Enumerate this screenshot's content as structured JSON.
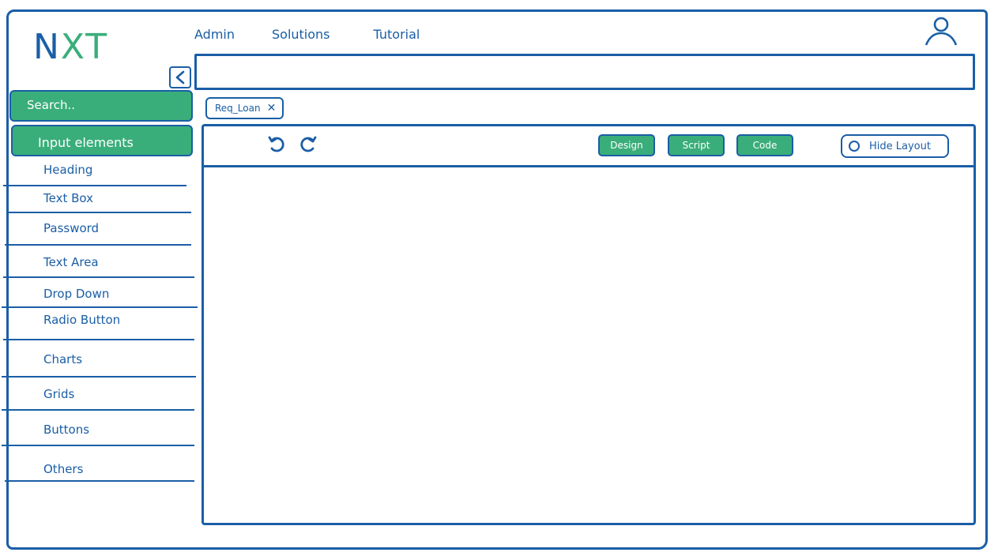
{
  "brand": {
    "logo_text": [
      "N",
      "X",
      "T"
    ]
  },
  "topnav": {
    "items": [
      "Admin",
      "Solutions",
      "Tutorial"
    ]
  },
  "search": {
    "placeholder": "Search.."
  },
  "sidebar": {
    "header": "Input elements",
    "items": [
      "Heading",
      "Text Box",
      "Password",
      "Text Area",
      "Drop Down",
      "Radio Button",
      "Charts",
      "Grids",
      "Buttons",
      "Others"
    ]
  },
  "tabs": [
    {
      "label": "Req_Loan"
    }
  ],
  "toolbar": {
    "undo_icon": "undo-icon",
    "redo_icon": "redo-icon",
    "modes": [
      "Design",
      "Script",
      "Code"
    ],
    "hide_layout_label": "Hide Layout"
  },
  "icons": {
    "user": "user-icon",
    "collapse": "chevron-left-icon",
    "close": "close-icon"
  },
  "colors": {
    "primary": "#1a5ea6",
    "accent": "#3aae7a",
    "background": "#ffffff"
  }
}
